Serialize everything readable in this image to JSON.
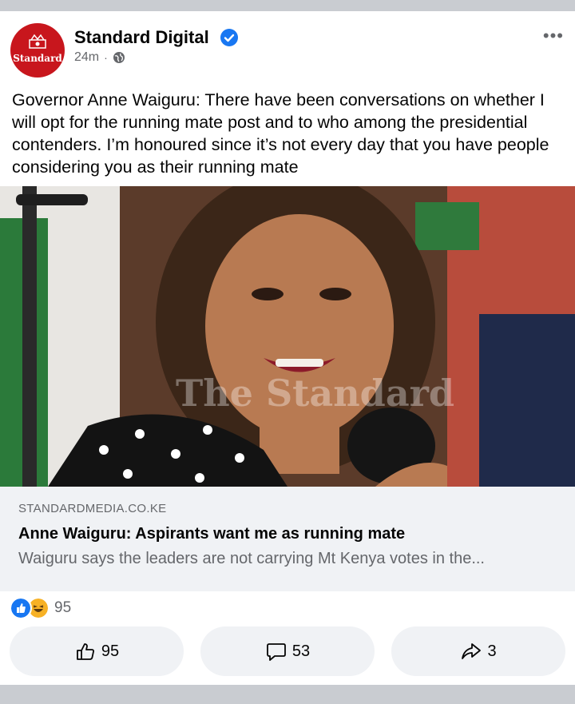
{
  "post": {
    "page_name": "Standard Digital",
    "avatar_text": "Standard",
    "time": "24m",
    "separator": "·",
    "more": "•••",
    "text": "Governor Anne Waiguru: There have been conversations on whether I will opt for the running mate post and to who among the presidential contenders. I’m honoured since it’s not every day that you have people considering you as their running mate",
    "photo_watermark": "The Standard",
    "link": {
      "domain": "STANDARDMEDIA.CO.KE",
      "title": "Anne Waiguru: Aspirants want me as running mate",
      "description": "Waiguru says the leaders are not carrying Mt Kenya votes in the..."
    },
    "reactions_count": "95",
    "actions": {
      "like_count": "95",
      "comment_count": "53",
      "share_count": "3"
    }
  },
  "colors": {
    "brand_red": "#c8161d",
    "verified_blue": "#1877f2",
    "secondary_text": "#65676b"
  }
}
